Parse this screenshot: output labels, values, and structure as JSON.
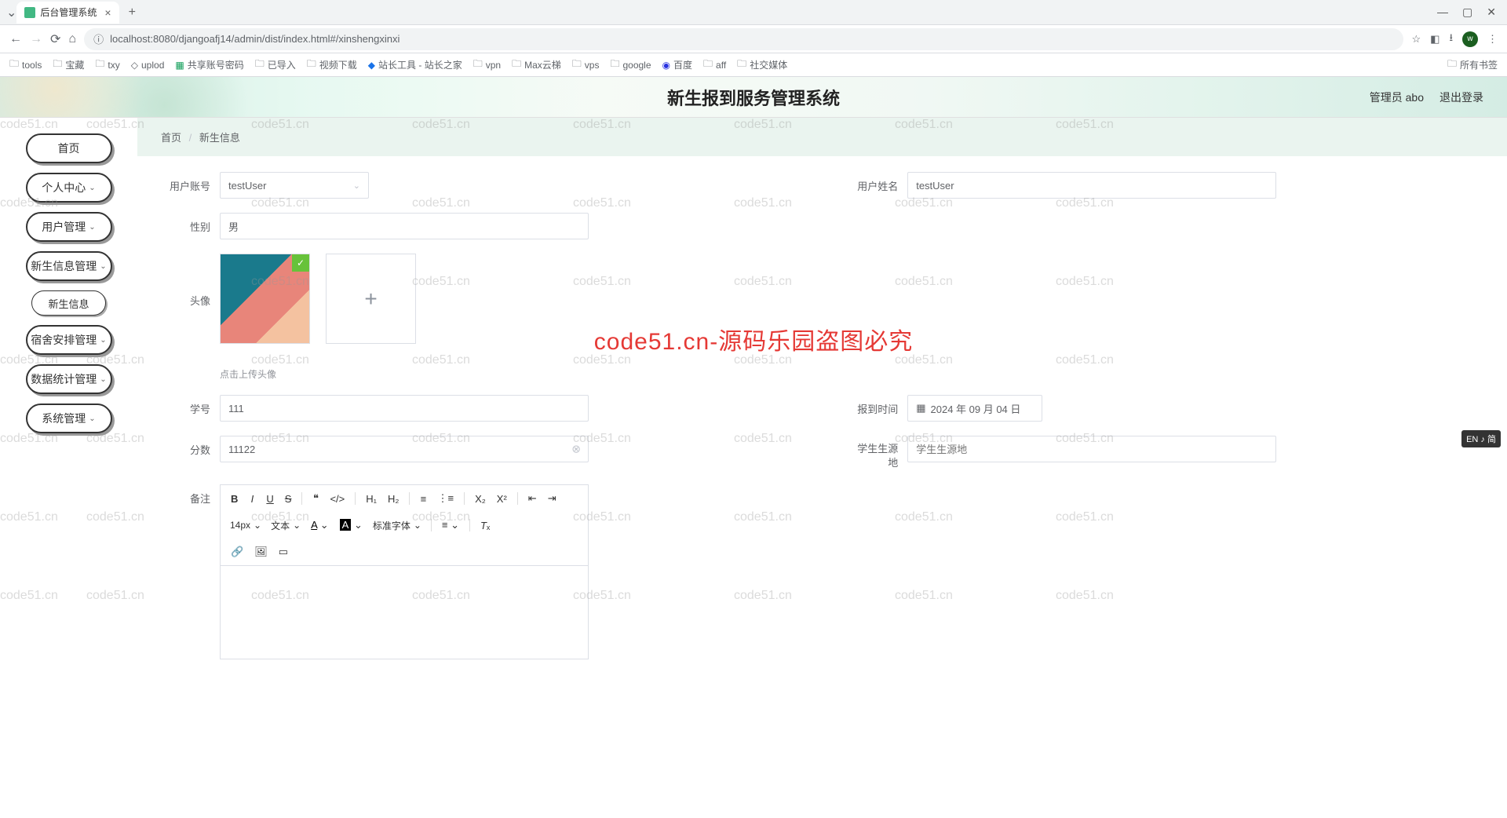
{
  "browser": {
    "tab_title": "后台管理系统",
    "url": "localhost:8080/djangoafj14/admin/dist/index.html#/xinshengxinxi",
    "bookmarks": [
      "tools",
      "宝藏",
      "txy",
      "uplod",
      "共享账号密码",
      "已导入",
      "视频下载",
      "站长工具 - 站长之家",
      "vpn",
      "Max云梯",
      "vps",
      "google",
      "百度",
      "aff",
      "社交媒体"
    ],
    "all_bookmarks": "所有书签"
  },
  "header": {
    "title": "新生报到服务管理系统",
    "user_label": "管理员 abo",
    "logout": "退出登录"
  },
  "sidebar": {
    "items": [
      {
        "label": "首页",
        "has_sub": false
      },
      {
        "label": "个人中心",
        "has_sub": true
      },
      {
        "label": "用户管理",
        "has_sub": true
      },
      {
        "label": "新生信息管理",
        "has_sub": true
      },
      {
        "label": "新生信息",
        "is_sub": true
      },
      {
        "label": "宿舍安排管理",
        "has_sub": true
      },
      {
        "label": "数据统计管理",
        "has_sub": true
      },
      {
        "label": "系统管理",
        "has_sub": true
      }
    ]
  },
  "breadcrumb": {
    "home": "首页",
    "current": "新生信息"
  },
  "form": {
    "account_label": "用户账号",
    "account_value": "testUser",
    "name_label": "用户姓名",
    "name_value": "testUser",
    "gender_label": "性别",
    "gender_value": "男",
    "avatar_label": "头像",
    "avatar_hint": "点击上传头像",
    "studentno_label": "学号",
    "studentno_value": "111",
    "checkin_label": "报到时间",
    "checkin_value": "2024 年 09 月 04 日",
    "score_label": "分数",
    "score_value": "11122",
    "origin_label": "学生生源地",
    "origin_placeholder": "学生生源地",
    "remark_label": "备注"
  },
  "editor": {
    "fontsize": "14px",
    "texttype": "文本",
    "fontfamily": "标准字体"
  },
  "watermark": {
    "repeat": "code51.cn",
    "main": "code51.cn-源码乐园盗图必究"
  },
  "ime": "EN ♪ 简"
}
